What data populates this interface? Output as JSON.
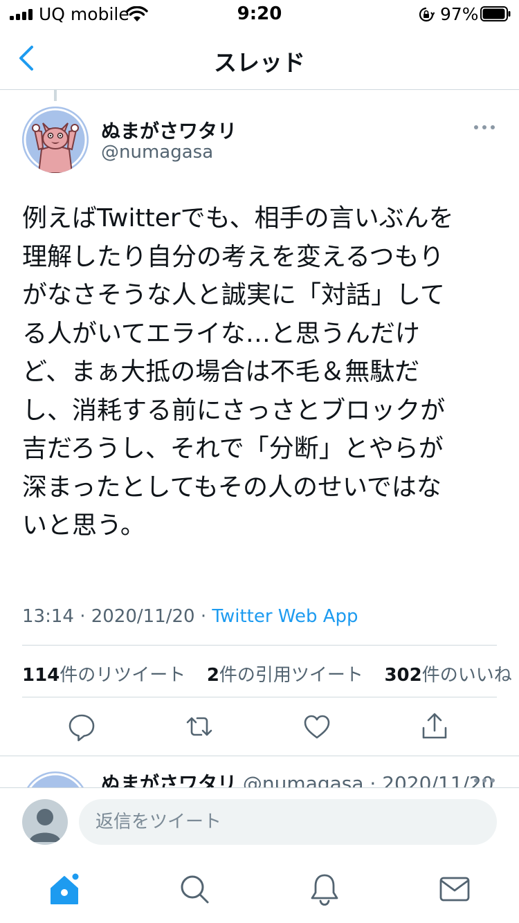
{
  "status_bar": {
    "carrier": "UQ mobile",
    "time": "9:20",
    "battery_percent": "97%",
    "battery_level": 0.97
  },
  "header": {
    "title": "スレッド"
  },
  "tweet": {
    "display_name": "ぬまがさワタリ",
    "handle": "@numagasa",
    "text_lines": [
      "例えばTwitterでも、相手の言いぶんを",
      "理解したり自分の考えを変えるつもり",
      "がなさそうな人と誠実に「対話」して",
      "る人がいてエライな…と思うんだけ",
      "ど、まぁ大抵の場合は不毛＆無駄だ",
      "し、消耗する前にさっさとブロックが",
      "吉だろうし、それで「分断」とやらが",
      "深まったとしてもその人のせいではな",
      "いと思う。"
    ],
    "time": "13:14",
    "date": "2020/11/20",
    "source": "Twitter Web App",
    "retweets_count": "114",
    "retweets_label": "件のリツイート",
    "quotes_count": "2",
    "quotes_label": "件の引用ツイート",
    "likes_count": "302",
    "likes_label": "件のいいね"
  },
  "reply_preview": {
    "display_name": "ぬまがさワタリ",
    "handle_date": "@numagasa · 2020/11/20"
  },
  "composer": {
    "placeholder": "返信をツイート"
  },
  "icons": {
    "reply": "reply-icon",
    "retweet": "retweet-icon",
    "like": "heart-icon",
    "share": "share-icon",
    "home": "home-icon",
    "search": "search-icon",
    "notifications": "bell-icon",
    "messages": "envelope-icon"
  },
  "colors": {
    "accent": "#1d9bf0",
    "secondary_text": "#536471",
    "border": "#cfd9de"
  }
}
